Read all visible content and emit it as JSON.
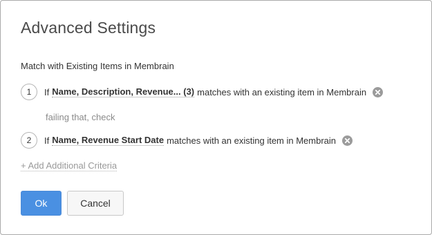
{
  "dialog": {
    "title": "Advanced Settings",
    "section_label": "Match with Existing Items in Membrain",
    "criteria": [
      {
        "number": "1",
        "prefix": "If",
        "fields": "Name, Description, Revenue... (3)",
        "suffix": "matches with an existing item in Membrain",
        "remove_icon": "remove-circle-icon"
      },
      {
        "number": "2",
        "prefix": "If",
        "fields": "Name, Revenue Start Date",
        "suffix": "matches with an existing item in Membrain",
        "remove_icon": "remove-circle-icon"
      }
    ],
    "fallback_text": "failing that, check",
    "add_criteria_label": "+ Add Additional Criteria"
  },
  "buttons": {
    "ok_label": "Ok",
    "cancel_label": "Cancel"
  },
  "colors": {
    "primary": "#4a90e2",
    "remove_icon": "#9b9b9b"
  }
}
